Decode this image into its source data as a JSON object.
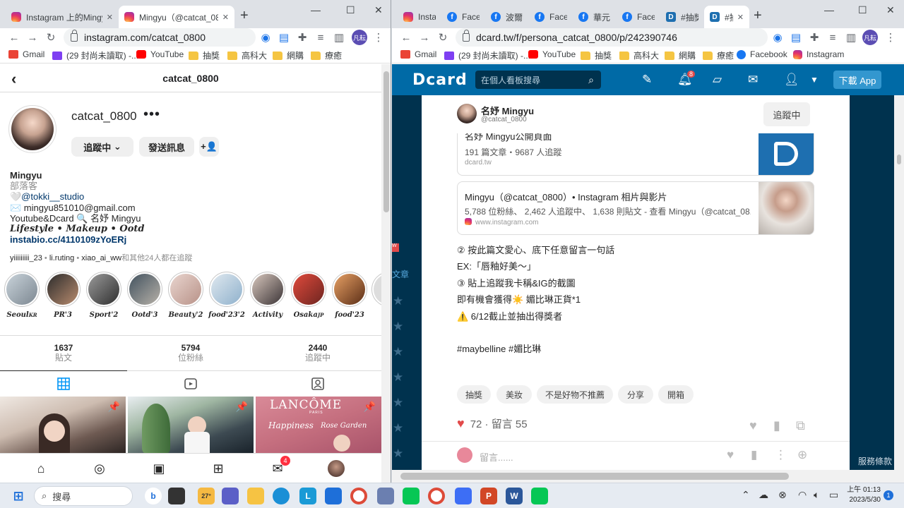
{
  "left_window": {
    "tabs": [
      {
        "title": "Instagram 上的Mingyu"
      },
      {
        "title": "Mingyu（@catcat_080"
      }
    ],
    "url": "instagram.com/catcat_0800",
    "profile_initials": "凡耘",
    "bookmarks": [
      "Gmail",
      "(29 封尚未讀取) -...",
      "YouTube",
      "抽獎",
      "高科大",
      "網購",
      "療癒"
    ]
  },
  "instagram": {
    "header_username": "catcat_0800",
    "username": "catcat_0800",
    "more": "•••",
    "follow_btn": "追蹤中",
    "message_btn": "發送訊息",
    "bio": {
      "name": "Mingyu",
      "category": "部落客",
      "studio": "🤍@tokki__studio",
      "email": "✉️ mingyu851010@gmail.com",
      "platforms": "Youtube&Dcard 🔍 名妤 Mingyu",
      "style": "𝑳𝒊𝒇𝒆𝒔𝒕𝒚𝒍𝒆 • 𝑴𝒂𝒌𝒆𝒖𝒑 • 𝑶𝒐𝒕𝒅",
      "style_plain": "Lifestyle • Makeup • Ootd",
      "link": "instabio.cc/4110109zYoERj"
    },
    "followed_by": {
      "users": [
        "yiiiiiiiii_23",
        "li.ruting",
        "xiao_ai_ww"
      ],
      "suffix": "和其他24人都在追蹤"
    },
    "highlights": [
      "Seoul",
      "PR'3",
      "Sport'2",
      "Ootd'3",
      "Beauty'2",
      "food'23'2",
      "Activity",
      "Osaka",
      "food'23"
    ],
    "highlight_suffix": {
      "Seoul": "KR",
      "Osaka": "JP"
    },
    "stats": [
      {
        "value": "1637",
        "label": "貼文"
      },
      {
        "value": "5794",
        "label": "位粉絲"
      },
      {
        "value": "2440",
        "label": "追蹤中"
      }
    ],
    "posts_text": {
      "lancome": "LANCÔME",
      "lancome_sub": "PARIS",
      "happiness": "Happiness",
      "rose": "Rose Garden"
    },
    "messenger_badge": "4"
  },
  "right_window": {
    "tabs": [
      "Instag",
      "Faceb",
      "波爾F",
      "Faceb",
      "華元台",
      "Faceb",
      "#抽獎",
      "#抽"
    ],
    "url": "dcard.tw/f/persona_catcat_0800/p/242390746",
    "profile_initials": "凡耘",
    "bookmarks": [
      "Gmail",
      "(29 封尚未讀取) -...",
      "YouTube",
      "抽獎",
      "高科大",
      "網購",
      "療癒",
      "Facebook",
      "Instagram"
    ]
  },
  "dcard": {
    "logo": "card",
    "search_placeholder": "在個人看板搜尋",
    "notif_badge": "8",
    "download": "下載 App",
    "author_name": "名妤 Mingyu",
    "author_handle": "@catcat_0800",
    "follow_btn": "追蹤中",
    "preview1": {
      "title": "名妤 Mingyu公開頁面",
      "sub": "191 篇文章・9687 人追蹤",
      "url": "dcard.tw"
    },
    "preview2": {
      "title": "Mingyu（@catcat_0800）• Instagram 相片與影片",
      "sub": "5,788 位粉絲、 2,462 人追蹤中、 1,638 則貼文 - 查看 Mingyu（@catcat_08...",
      "url": "www.instagram.com"
    },
    "lines": [
      "② 按此篇文愛心、底下任意留言一句話",
      "EX:「唇釉好美～」",
      "③ 貼上追蹤我卡稱&IG的截圖",
      "即有機會獲得☀️ 媚比琳正貨*1",
      "⚠️ 6/12截止並抽出得獎者",
      "",
      "#maybelline #媚比琳"
    ],
    "tags": [
      "抽獎",
      "美妝",
      "不是好物不推薦",
      "分享",
      "開箱"
    ],
    "reactions": "72 · 留言 55",
    "comment_placeholder": "留言......",
    "left_label": "文章",
    "left_badge": "W",
    "terms": "服務條款"
  },
  "taskbar": {
    "search": "搜尋",
    "weather": "27°",
    "time": "上午 01:13",
    "date": "2023/5/30",
    "notifications": "1"
  }
}
